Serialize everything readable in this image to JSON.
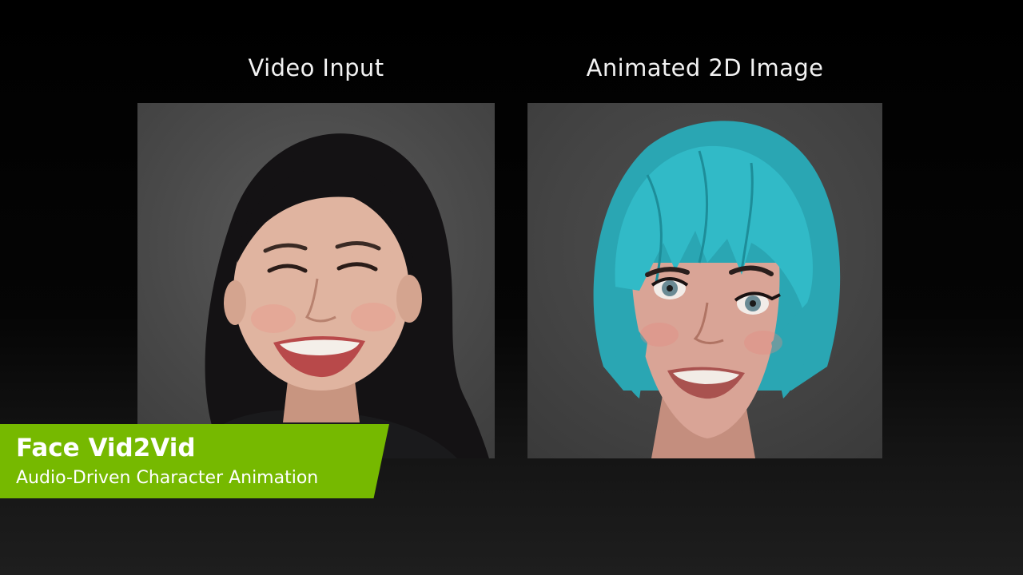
{
  "captions": {
    "left": "Video Input",
    "right": "Animated 2D Image"
  },
  "lower_third": {
    "title": "Face Vid2Vid",
    "subtitle": "Audio-Driven Character Animation"
  },
  "colors": {
    "accent_green": "#76b900",
    "avatar_hair": "#2fb8c4",
    "background": "#000000"
  }
}
